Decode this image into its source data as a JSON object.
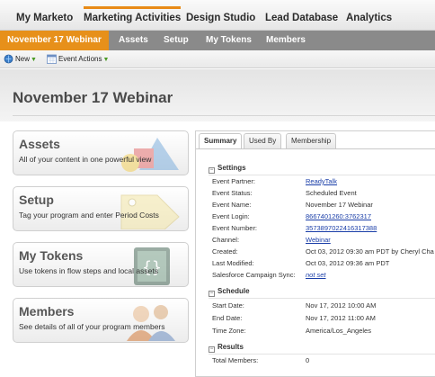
{
  "topnav": {
    "tabs": [
      {
        "label": "My Marketo",
        "active": false
      },
      {
        "label": "Marketing Activities",
        "active": true
      },
      {
        "label": "Design Studio",
        "active": false
      },
      {
        "label": "Lead Database",
        "active": false
      },
      {
        "label": "Analytics",
        "active": false
      }
    ]
  },
  "subnav": {
    "items": [
      "November 17 Webinar",
      "Assets",
      "Setup",
      "My Tokens",
      "Members"
    ]
  },
  "toolbar": {
    "new_label": "New",
    "event_actions_label": "Event Actions"
  },
  "page": {
    "title": "November 17 Webinar"
  },
  "cards": [
    {
      "title": "Assets",
      "desc": "All of your content in one powerful view",
      "icon": "shapes-icon"
    },
    {
      "title": "Setup",
      "desc": "Tag your program and enter Period Costs",
      "icon": "tag-icon"
    },
    {
      "title": "My Tokens",
      "desc": "Use tokens in flow steps and local assets",
      "icon": "token-icon"
    },
    {
      "title": "Members",
      "desc": "See details of all of your program members",
      "icon": "people-icon"
    }
  ],
  "panel": {
    "tabs": [
      "Summary",
      "Used By",
      "Membership"
    ],
    "settings": {
      "header": "Settings",
      "rows": [
        {
          "label": "Event Partner:",
          "value": "ReadyTalk",
          "link": true
        },
        {
          "label": "Event Status:",
          "value": "Scheduled Event"
        },
        {
          "label": "Event Name:",
          "value": "November 17 Webinar"
        },
        {
          "label": "Event Login:",
          "value": "8667401260:3762317",
          "link": true
        },
        {
          "label": "Event Number:",
          "value": "3573897022416317388",
          "link": true
        },
        {
          "label": "Channel:",
          "value": "Webinar",
          "link": true
        },
        {
          "label": "Created:",
          "value": "Oct 03, 2012 09:30 am PDT by Cheryl Cha"
        },
        {
          "label": "Last Modified:",
          "value": "Oct 03, 2012 09:36 am PDT"
        },
        {
          "label": "Salesforce Campaign Sync:",
          "value": "not set",
          "link": true,
          "italic": true
        }
      ]
    },
    "schedule": {
      "header": "Schedule",
      "rows": [
        {
          "label": "Start Date:",
          "value": "Nov 17, 2012 10:00 AM"
        },
        {
          "label": "End Date:",
          "value": "Nov 17, 2012 11:00 AM"
        },
        {
          "label": "Time Zone:",
          "value": "America/Los_Angeles"
        }
      ]
    },
    "results": {
      "header": "Results",
      "rows": [
        {
          "label": "Total Members:",
          "value": "0"
        }
      ]
    }
  },
  "colors": {
    "accent": "#e88a16",
    "subnav_bg": "#8a8a8a",
    "link": "#1a3ea8"
  }
}
